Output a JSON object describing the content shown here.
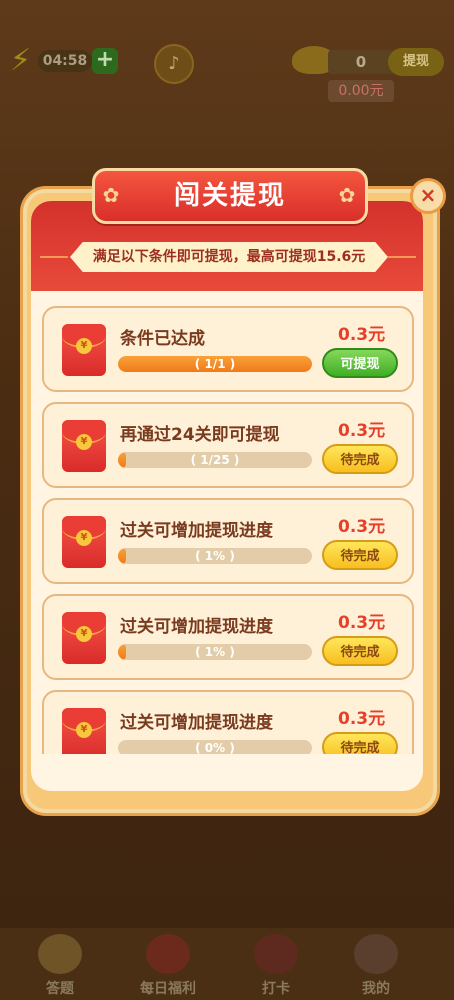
{
  "topbar": {
    "timer": "04:58",
    "plus_label": "+",
    "coin_count": "0",
    "withdraw_label": "提现",
    "money": "0.00元"
  },
  "modal": {
    "title": "闯关提现",
    "close_label": "×",
    "subtitle": "满足以下条件即可提现，最高可提现15.6元",
    "tasks": [
      {
        "title": "条件已达成",
        "amount": "0.3元",
        "progress_text": "( 1/1 )",
        "progress": 1.0,
        "button": "可提现",
        "button_style": "green"
      },
      {
        "title": "再通过24关即可提现",
        "amount": "0.3元",
        "progress_text": "( 1/25 )",
        "progress": 0.04,
        "button": "待完成",
        "button_style": "yellow"
      },
      {
        "title": "过关可增加提现进度",
        "amount": "0.3元",
        "progress_text": "( 1% )",
        "progress": 0.01,
        "button": "待完成",
        "button_style": "yellow"
      },
      {
        "title": "过关可增加提现进度",
        "amount": "0.3元",
        "progress_text": "( 1% )",
        "progress": 0.01,
        "button": "待完成",
        "button_style": "yellow"
      },
      {
        "title": "过关可增加提现进度",
        "amount": "0.3元",
        "progress_text": "( 0% )",
        "progress": 0.0,
        "button": "待完成",
        "button_style": "yellow"
      }
    ]
  },
  "bottom_nav": [
    {
      "label": "答题",
      "icon": "quiz-icon"
    },
    {
      "label": "每日福利",
      "icon": "gift-icon"
    },
    {
      "label": "打卡",
      "icon": "checkin-icon"
    },
    {
      "label": "我的",
      "icon": "profile-icon"
    }
  ],
  "colors": {
    "title_red": "#d92f2a",
    "amount_red": "#e6402a",
    "progress_orange": "#f07a18",
    "button_green": "#3fae25",
    "button_yellow": "#f8bf1e"
  }
}
